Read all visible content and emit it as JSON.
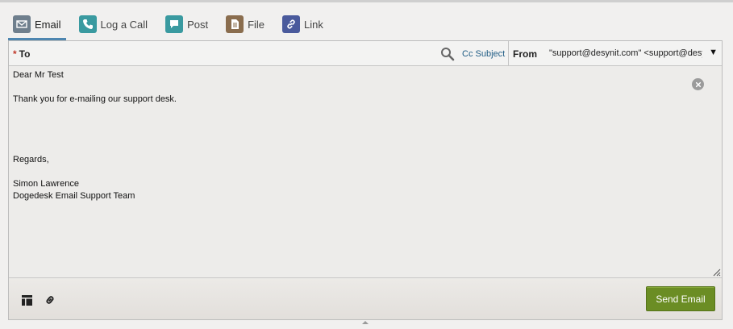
{
  "tabs": [
    {
      "label": "Email",
      "icon": "envelope-icon",
      "color": "#6f7f8d",
      "active": true
    },
    {
      "label": "Log a Call",
      "icon": "phone-icon",
      "color": "#3a9aa0",
      "active": false
    },
    {
      "label": "Post",
      "icon": "speech-bubble-icon",
      "color": "#3a9aa0",
      "active": false
    },
    {
      "label": "File",
      "icon": "document-icon",
      "color": "#8a6d4e",
      "active": false
    },
    {
      "label": "Link",
      "icon": "link-icon",
      "color": "#4a5a9c",
      "active": false
    }
  ],
  "header": {
    "required_marker": "*",
    "to_label": "To",
    "cc_subject_label": "Cc Subject",
    "from_label": "From",
    "from_value": "\"support@desynit.com\" <support@desynit.com>",
    "from_caret": "▼"
  },
  "body_lines": [
    "Dear Mr Test",
    "",
    "Thank you for e-mailing our support desk.",
    "",
    "",
    "",
    "",
    "Regards,",
    "",
    "Simon Lawrence",
    "Dogedesk Email Support Team"
  ],
  "footer": {
    "send_label": "Send Email"
  },
  "colors": {
    "accent": "#4e86b0",
    "send_button": "#6b8d24",
    "link": "#1f5c84",
    "required": "#c0392b"
  }
}
